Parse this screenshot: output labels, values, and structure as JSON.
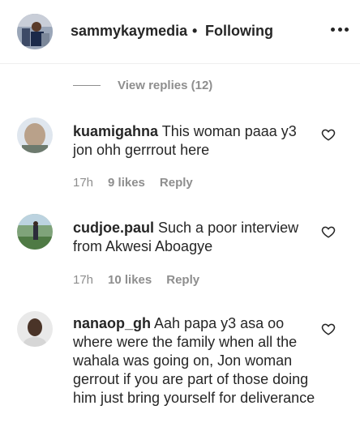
{
  "header": {
    "username": "sammykaymedia",
    "separator": "•",
    "follow_state": "Following"
  },
  "replies": {
    "label": "View replies (12)"
  },
  "comments": [
    {
      "username": "kuamigahna",
      "text": "This woman paaa y3 jon ohh gerrrout here",
      "time": "17h",
      "likes": "9 likes",
      "reply": "Reply"
    },
    {
      "username": "cudjoe.paul",
      "text": "Such a poor interview from Akwesi Aboagye",
      "time": "17h",
      "likes": "10 likes",
      "reply": "Reply"
    },
    {
      "username": "nanaop_gh",
      "text": "Aah papa y3 asa oo where were the family when all the wahala was going on, Jon woman gerrout if you are part of those doing him just bring yourself for deliverance"
    }
  ],
  "icons": {
    "more": "more-options-icon",
    "like": "heart-icon"
  }
}
